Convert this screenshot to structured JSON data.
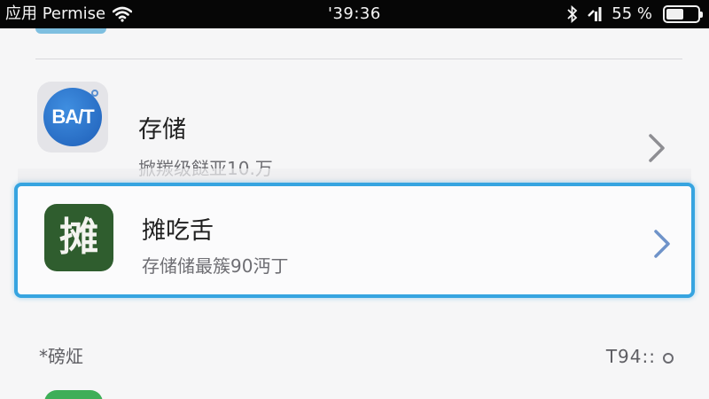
{
  "status_bar": {
    "carrier": "应用 Permise",
    "time": "'39:36",
    "battery_label": "55 %",
    "battery_percent": 55,
    "icons": [
      "wifi-icon",
      "bluetooth-icon",
      "signal-icon",
      "battery-icon"
    ]
  },
  "rows": [
    {
      "title": "存储",
      "subtitle": "掀羰级餸亚10.万",
      "icon": {
        "name": "bat-app-icon",
        "text": "BA/T"
      }
    },
    {
      "title": "摊吃舌",
      "subtitle": "存储储最簇90沔丁",
      "icon": {
        "name": "tan-app-icon",
        "text": "摊"
      },
      "selected": true
    }
  ],
  "footer": {
    "left_text": "*磅炡",
    "right_text": "T94::"
  },
  "colors": {
    "highlight": "#36a4e0",
    "status_bar_bg": "#060606",
    "tan_icon_bg": "#2f5d2e",
    "bat_icon_bg": "#1f5fb8"
  }
}
